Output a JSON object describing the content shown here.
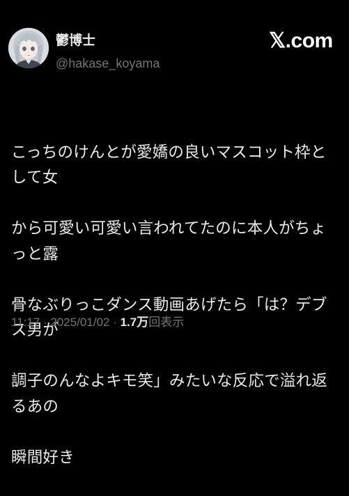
{
  "brand": {
    "logo_text": "𝕏.com",
    "icon": "x-logo-icon"
  },
  "author": {
    "display_name": "鬱博士",
    "handle": "@hakase_koyama",
    "avatar": "avatar-image-anime-girl-silver-hair"
  },
  "tweet": {
    "lines": [
      "こっちのけんとが愛嬌の良いマスコット枠として女",
      "から可愛い可愛い言われてたのに本人がちょっと露",
      "骨なぶりっこダンス動画あげたら「は？デブス男が",
      "調子のんなよキモ笑」みたいな反応で溢れ返るあの",
      "瞬間好き"
    ]
  },
  "meta": {
    "time": "11:17",
    "separator": " · ",
    "date": "2025/01/02",
    "views_count": "1.7万",
    "views_label": "回表示"
  },
  "colors": {
    "background": "#000000",
    "primary_text": "#e7e9ea",
    "secondary_text": "#71767b"
  }
}
